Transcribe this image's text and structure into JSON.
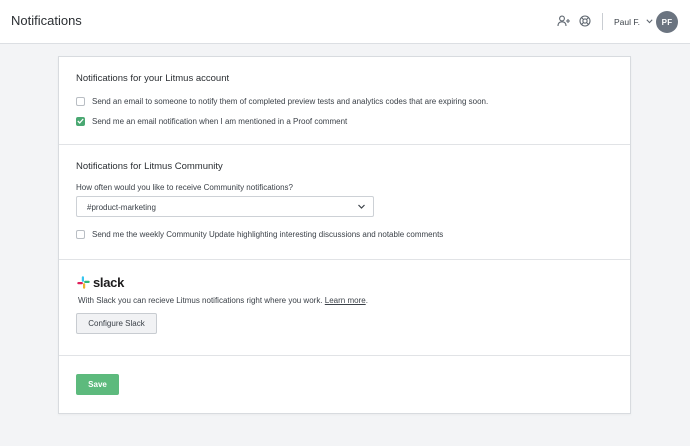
{
  "header": {
    "title": "Notifications",
    "invite_icon": "add-user-icon",
    "help_icon": "support-icon",
    "user_name": "Paul F.",
    "avatar_initials": "PF"
  },
  "account_section": {
    "title": "Notifications for your Litmus account",
    "options": [
      {
        "label": "Send an email to someone to notify them of completed preview tests and analytics codes that are expiring soon.",
        "checked": false
      },
      {
        "label": "Send me an email notification when I am mentioned in a Proof comment",
        "checked": true
      }
    ]
  },
  "community_section": {
    "title": "Notifications for Litmus Community",
    "frequency_label": "How often would you like to receive Community notifications?",
    "frequency_value": "#product-marketing",
    "weekly_update": {
      "label": "Send me the weekly Community Update highlighting interesting discussions and notable comments",
      "checked": false
    }
  },
  "slack_section": {
    "logo_text": "slack",
    "description": "With Slack you can recieve Litmus notifications right where you work.",
    "learn_more": "Learn more",
    "period": ".",
    "configure_label": "Configure Slack"
  },
  "footer": {
    "save_label": "Save"
  },
  "colors": {
    "accent_green": "#5dba7d",
    "checkbox_green": "#4aa872",
    "avatar_bg": "#6b7480"
  }
}
